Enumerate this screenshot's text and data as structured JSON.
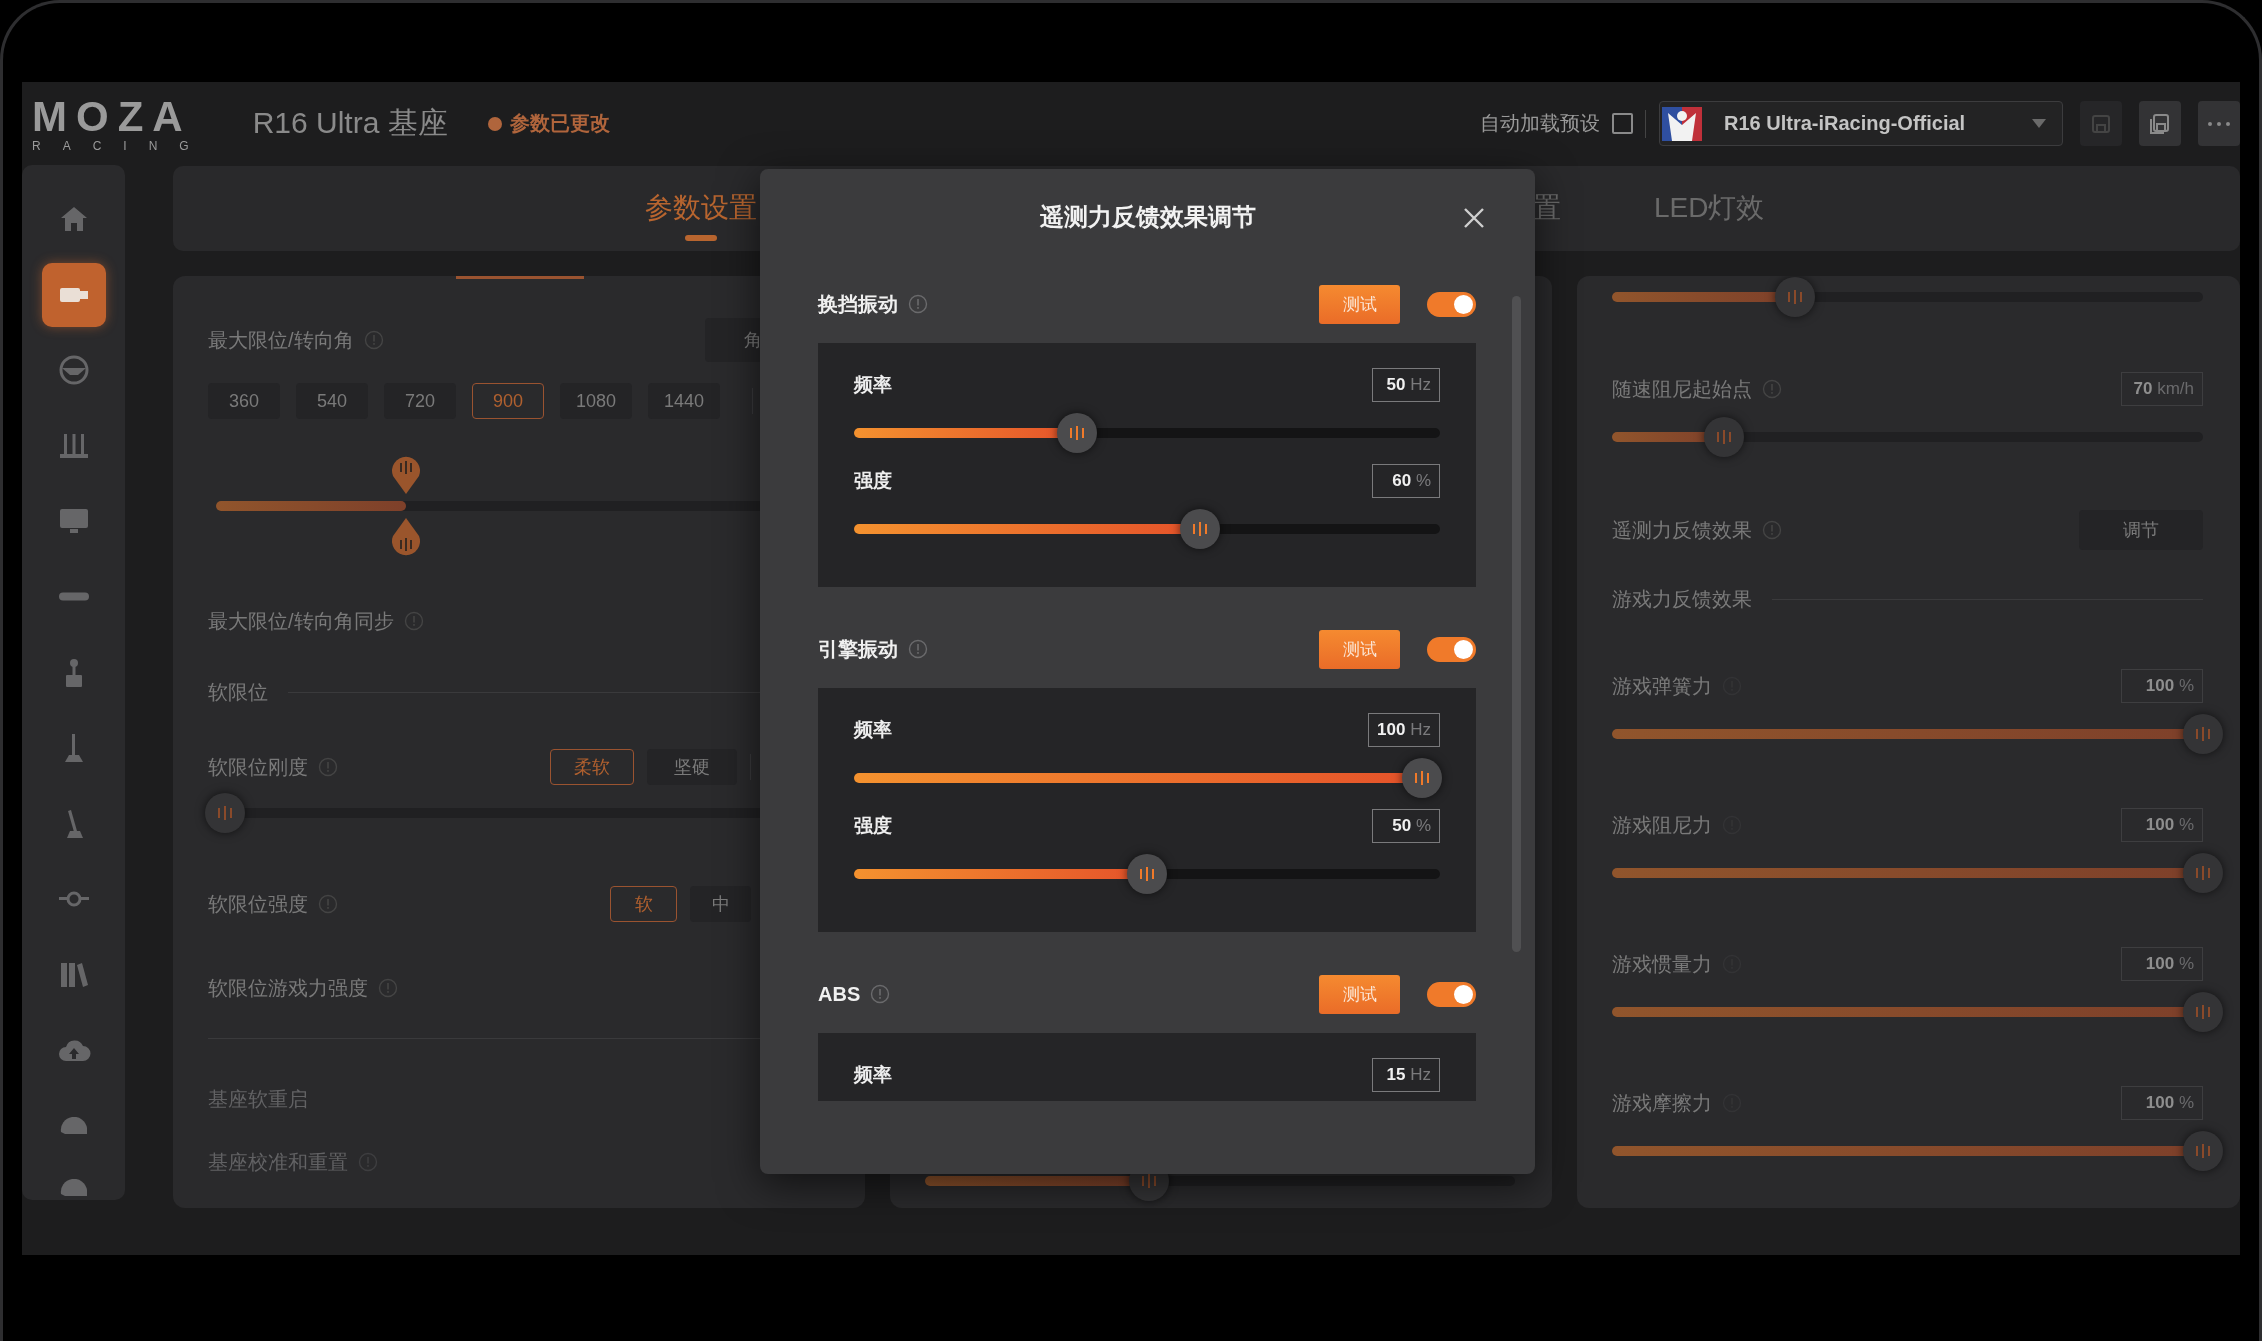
{
  "header": {
    "logo": {
      "wordmark": "MOZA",
      "tagline": "RACING"
    },
    "device": "R16 Ultra 基座",
    "status": "参数已更改",
    "auto_load": {
      "label": "自动加载预设",
      "checked": false
    },
    "preset": {
      "name": "R16 Ultra-iRacing-Official"
    },
    "actions": [
      {
        "kind": "save",
        "disabled": true
      },
      {
        "kind": "save-as",
        "disabled": false
      },
      {
        "kind": "more",
        "disabled": false
      }
    ]
  },
  "sidebar": {
    "items": [
      {
        "selected": false
      },
      {
        "selected": true
      },
      {
        "selected": false
      },
      {
        "selected": false
      },
      {
        "selected": false
      },
      {
        "selected": false
      },
      {
        "selected": false
      },
      {
        "selected": false
      },
      {
        "selected": false
      },
      {
        "selected": false
      },
      {
        "selected": false
      },
      {
        "selected": false
      },
      {
        "selected": false
      },
      {
        "selected": false
      }
    ]
  },
  "tabs": [
    {
      "label": "参数设置",
      "selected": true
    },
    {
      "label": "置",
      "selected": false
    },
    {
      "label": "LED灯效",
      "selected": false
    }
  ],
  "left_panel": {
    "max_angle": {
      "label": "最大限位/转向角",
      "mode_button": "角",
      "options": [
        {
          "label": "360",
          "selected": false
        },
        {
          "label": "540",
          "selected": false
        },
        {
          "label": "720",
          "selected": false
        },
        {
          "label": "900",
          "selected": true
        },
        {
          "label": "1080",
          "selected": false
        },
        {
          "label": "1440",
          "selected": false
        }
      ]
    },
    "range_slider": {
      "level": 0.31
    },
    "sync": {
      "label": "最大限位/转向角同步"
    },
    "section": "软限位",
    "stiffness": {
      "label": "软限位刚度",
      "options": [
        {
          "label": "柔软",
          "selected": true
        },
        {
          "label": "坚硬",
          "selected": false
        }
      ],
      "level": 0
    },
    "strength": {
      "label": "软限位强度",
      "options": [
        {
          "label": "软",
          "selected": true
        },
        {
          "label": "中",
          "selected": false
        }
      ]
    },
    "game_strength": {
      "label": "软限位游戏力强度"
    },
    "soft_restart": {
      "label": "基座软重启"
    },
    "calibrate": {
      "label": "基座校准和重置"
    }
  },
  "middle_panel": {
    "level": 0.38
  },
  "right_panel": {
    "top_slider": {
      "level": 0.31
    },
    "speed_damping": {
      "label": "随速阻尼起始点",
      "value": "70",
      "unit": "km/h",
      "level": 0.19
    },
    "telemetry": {
      "label": "遥测力反馈效果",
      "button": "调节"
    },
    "section": "游戏力反馈效果",
    "game_forces": [
      {
        "label": "游戏弹簧力",
        "value": "100",
        "unit": "%",
        "level": 1
      },
      {
        "label": "游戏阻尼力",
        "value": "100",
        "unit": "%",
        "level": 1
      },
      {
        "label": "游戏惯量力",
        "value": "100",
        "unit": "%",
        "level": 1
      },
      {
        "label": "游戏摩擦力",
        "value": "100",
        "unit": "%",
        "level": 1
      }
    ]
  },
  "dialog": {
    "title": "遥测力反馈效果调节",
    "sections": [
      {
        "title": "换挡振动",
        "test": "测试",
        "on": true,
        "params": [
          {
            "label": "频率",
            "value": "50",
            "unit": "Hz",
            "level": 0.38
          },
          {
            "label": "强度",
            "value": "60",
            "unit": "%",
            "level": 0.59
          }
        ]
      },
      {
        "title": "引擎振动",
        "test": "测试",
        "on": true,
        "params": [
          {
            "label": "频率",
            "value": "100",
            "unit": "Hz",
            "level": 0.97
          },
          {
            "label": "强度",
            "value": "50",
            "unit": "%",
            "level": 0.5
          }
        ]
      },
      {
        "title": "ABS",
        "test": "测试",
        "on": true,
        "params": [
          {
            "label": "频率",
            "value": "15",
            "unit": "Hz"
          }
        ]
      }
    ]
  }
}
